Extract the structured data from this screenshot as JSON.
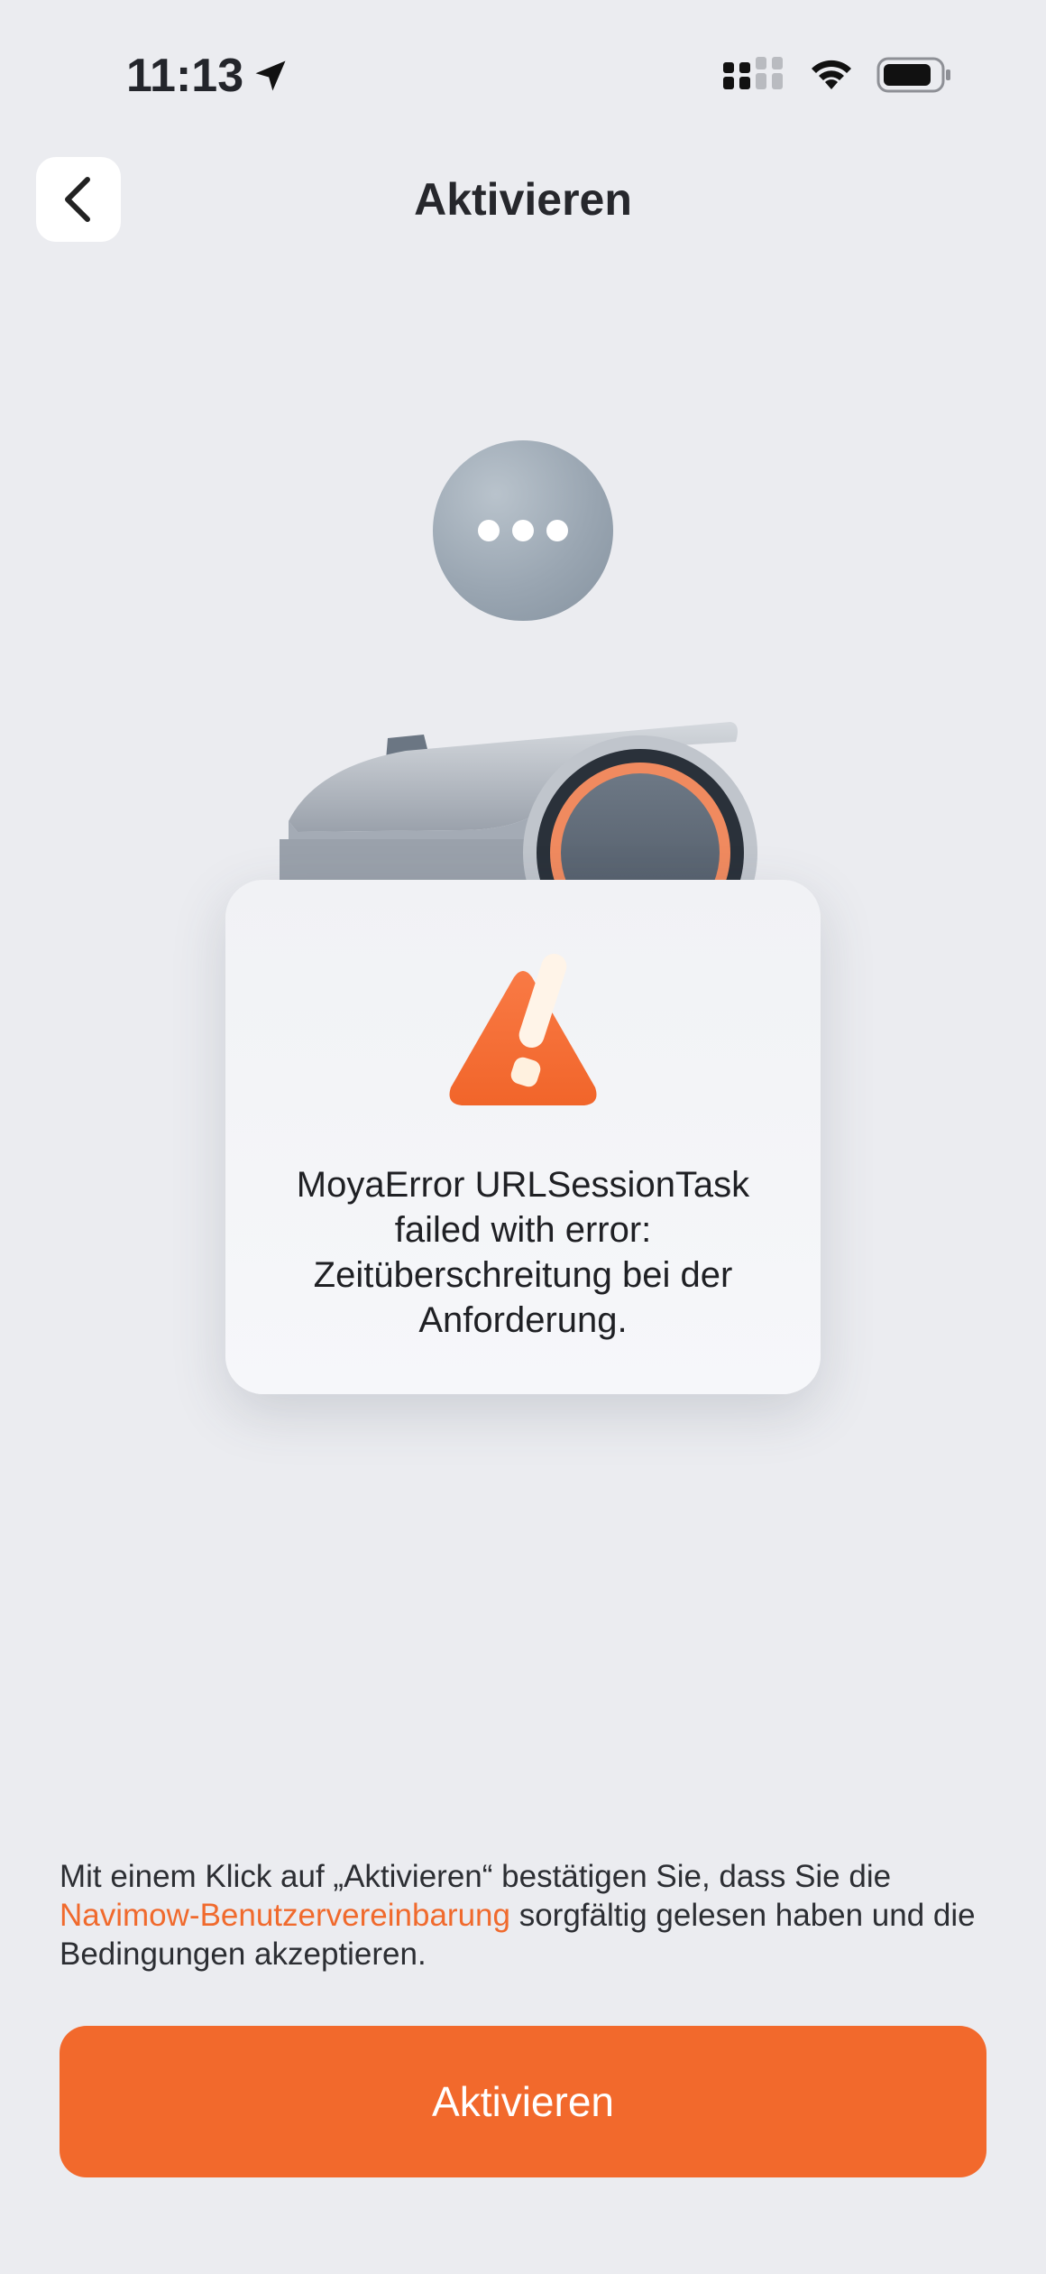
{
  "status_bar": {
    "time": "11:13"
  },
  "header": {
    "title": "Aktivieren"
  },
  "error_dialog": {
    "message": "MoyaError URLSessionTask failed with error: Zeitüberschreitung bei der Anforderung."
  },
  "agreement": {
    "text_before": "Mit einem Klick auf „Aktivieren“ bestätigen Sie, dass Sie die ",
    "link": "Navimow-Benutzervereinbarung",
    "text_after": " sorgfältig gelesen haben und die Bedingungen akzeptieren."
  },
  "primary_button": {
    "label": "Aktivieren"
  },
  "colors": {
    "accent": "#f2692c",
    "background": "#ebecf0"
  }
}
